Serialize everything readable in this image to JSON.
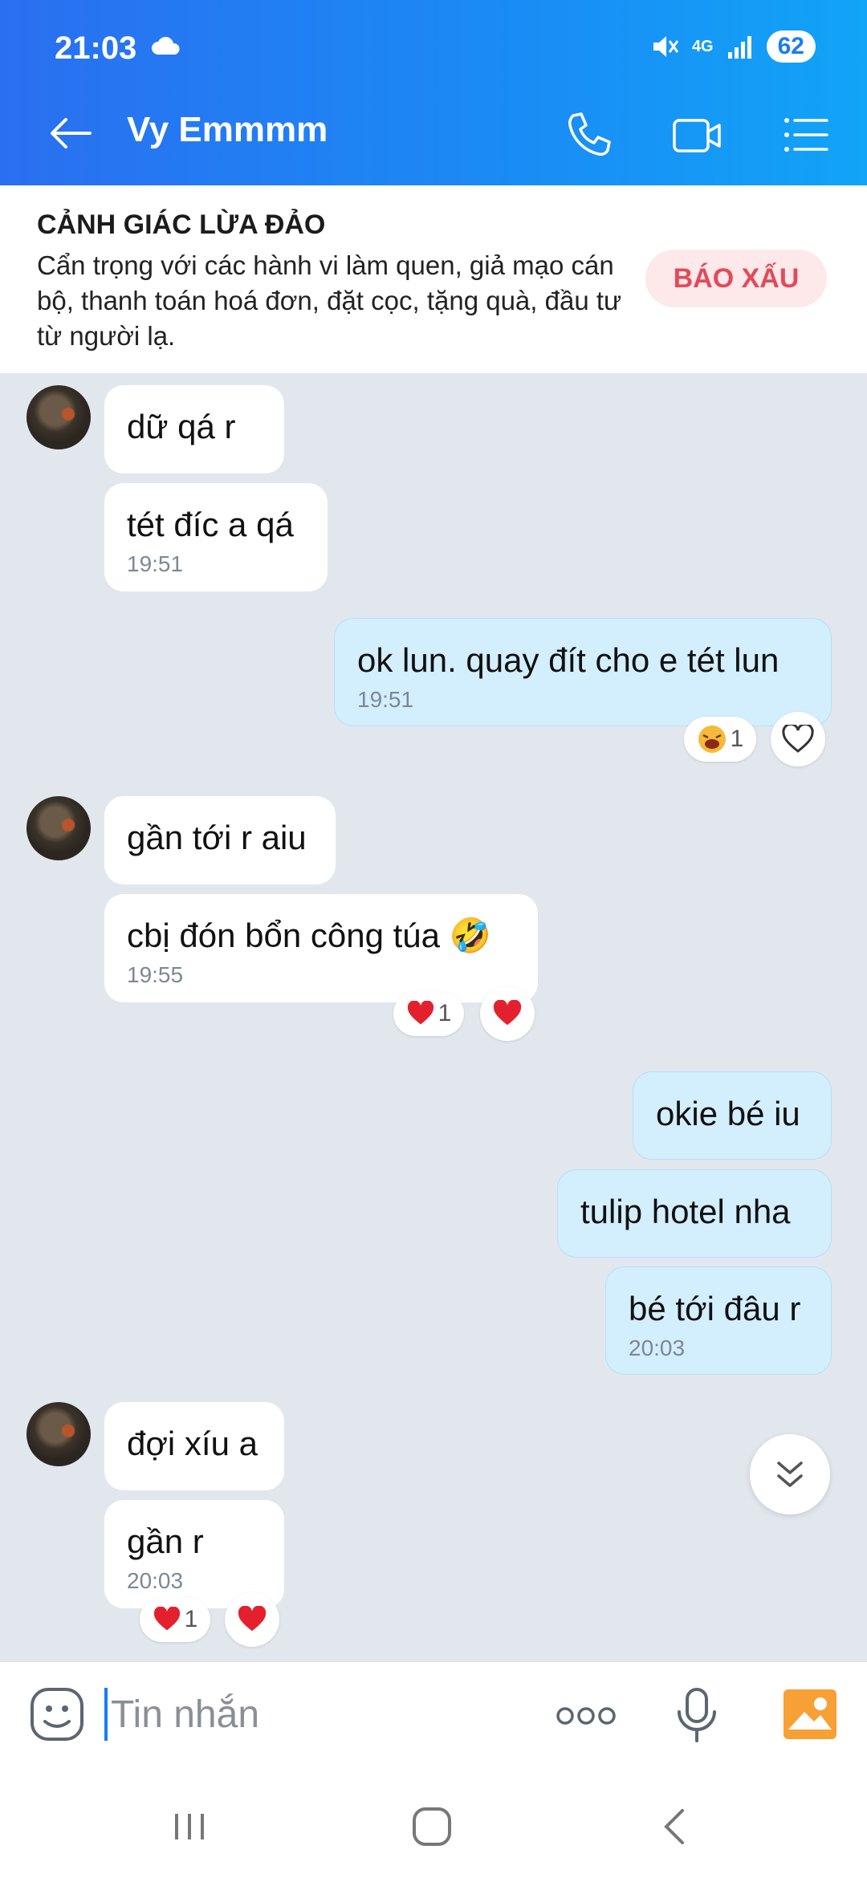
{
  "status": {
    "time": "21:03",
    "network": "4G",
    "battery": "62"
  },
  "header": {
    "contact_name": "Vy Emmmm"
  },
  "warning": {
    "title": "CẢNH GIÁC LỪA ĐẢO",
    "text": "Cẩn trọng với các hành vi làm quen, giả mạo cán bộ, thanh toán hoá đơn, đặt cọc, tặng quà, đầu tư từ người lạ.",
    "report_label": "BÁO XẤU"
  },
  "messages": [
    {
      "side": "in",
      "text": "dữ qá r"
    },
    {
      "side": "in",
      "text": "tét đíc a qá",
      "time": "19:51"
    },
    {
      "side": "out",
      "text": "ok lun. quay đít cho e tét lun",
      "time": "19:51",
      "reaction_count": "1"
    },
    {
      "side": "in",
      "text": "gần tới r aiu"
    },
    {
      "side": "in",
      "text": "cbị đón bổn công túa 🤣",
      "time": "19:55",
      "reaction_count": "1"
    },
    {
      "side": "out",
      "text": "okie bé iu"
    },
    {
      "side": "out",
      "text": "tulip hotel nha"
    },
    {
      "side": "out",
      "text": "bé tới đâu r",
      "time": "20:03"
    },
    {
      "side": "in",
      "text": "đợi xíu a"
    },
    {
      "side": "in",
      "text": "gần r",
      "time": "20:03",
      "reaction_count": "1"
    }
  ],
  "composer": {
    "placeholder": "Tin nhắn"
  },
  "colors": {
    "header_start": "#2a6ff0",
    "header_end": "#11a4f7",
    "out_bubble": "#d3eefd",
    "in_bubble": "#ffffff",
    "chat_bg": "#e2e7ee",
    "report_text": "#e04b5a"
  }
}
